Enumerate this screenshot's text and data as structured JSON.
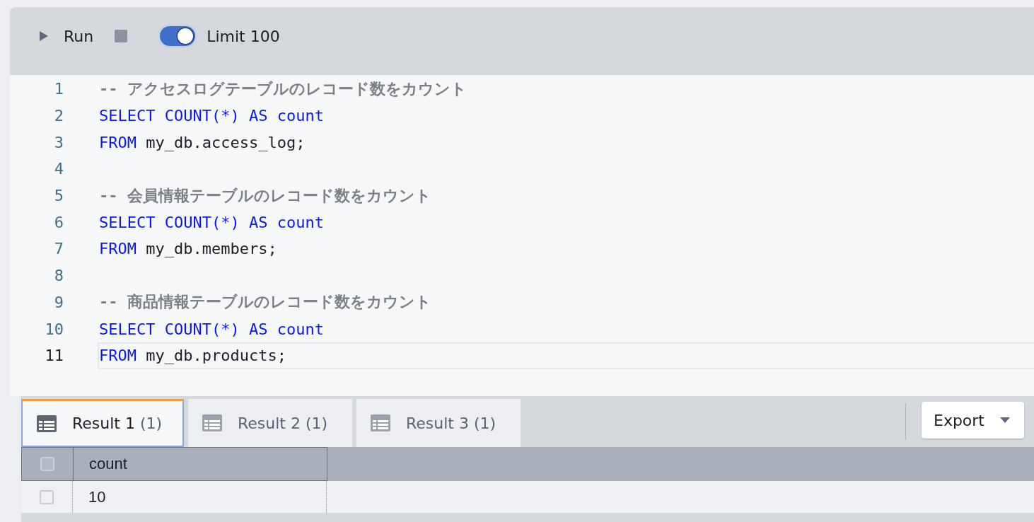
{
  "toolbar": {
    "run_label": "Run",
    "limit_toggle": {
      "label": "Limit 100",
      "on": true
    }
  },
  "editor": {
    "lines": [
      {
        "number": "1",
        "active": false,
        "tokens": [
          {
            "kind": "comment",
            "text": "-- アクセスログテーブルのレコード数をカウント"
          }
        ]
      },
      {
        "number": "2",
        "active": false,
        "tokens": [
          {
            "kind": "keyword",
            "text": "SELECT COUNT(*) AS count"
          }
        ]
      },
      {
        "number": "3",
        "active": false,
        "tokens": [
          {
            "kind": "keyword",
            "text": "FROM"
          },
          {
            "kind": "plain",
            "text": " my_db.access_log;"
          }
        ]
      },
      {
        "number": "4",
        "active": false
      },
      {
        "number": "5",
        "active": false,
        "tokens": [
          {
            "kind": "comment",
            "text": "-- 会員情報テーブルのレコード数をカウント"
          }
        ]
      },
      {
        "number": "6",
        "active": false,
        "tokens": [
          {
            "kind": "keyword",
            "text": "SELECT COUNT(*) AS count"
          }
        ]
      },
      {
        "number": "7",
        "active": false,
        "tokens": [
          {
            "kind": "keyword",
            "text": "FROM"
          },
          {
            "kind": "plain",
            "text": " my_db.members;"
          }
        ]
      },
      {
        "number": "8",
        "active": false
      },
      {
        "number": "9",
        "active": false,
        "tokens": [
          {
            "kind": "comment",
            "text": "-- 商品情報テーブルのレコード数をカウント"
          }
        ]
      },
      {
        "number": "10",
        "active": false,
        "tokens": [
          {
            "kind": "keyword",
            "text": "SELECT COUNT(*) AS count"
          }
        ]
      },
      {
        "number": "11",
        "active": true,
        "tokens": [
          {
            "kind": "keyword",
            "text": "FROM"
          },
          {
            "kind": "plain",
            "text": " my_db.products;"
          }
        ]
      }
    ]
  },
  "result_tabs": [
    {
      "label": "Result 1",
      "count": "(1)",
      "selected": true
    },
    {
      "label": "Result 2",
      "count": "(1)",
      "selected": false
    },
    {
      "label": "Result 3",
      "count": "(1)",
      "selected": false
    }
  ],
  "export_button": "Export",
  "table": {
    "select_all_checked": false,
    "columns": [
      "count"
    ],
    "rows": [
      {
        "checked": false,
        "cells": [
          "10"
        ]
      }
    ]
  }
}
